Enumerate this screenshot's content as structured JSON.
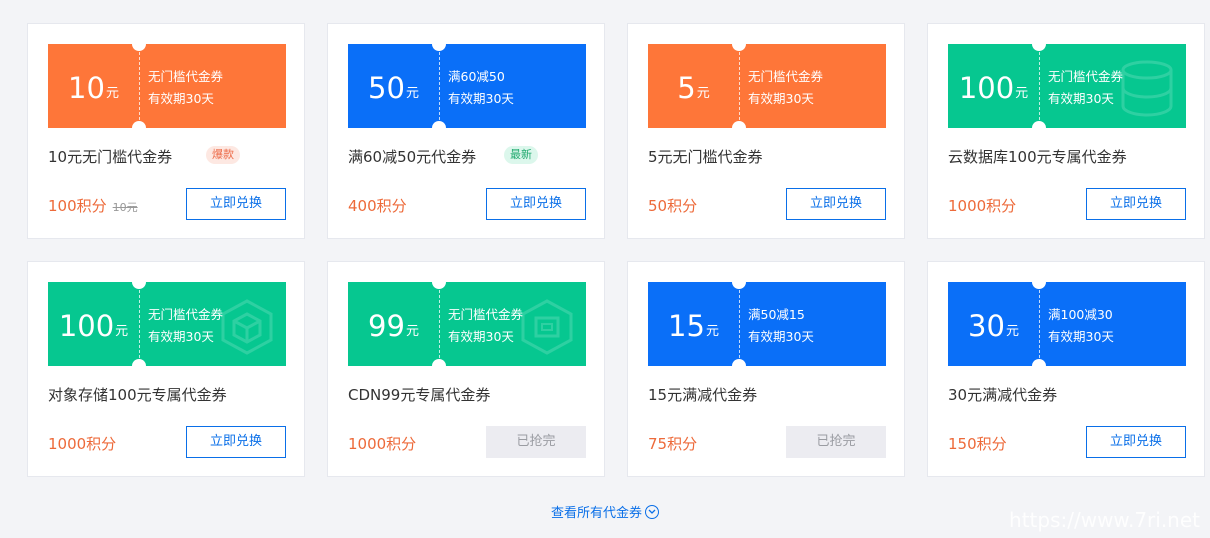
{
  "colors": {
    "orange": "#fe7639",
    "blue": "#0a6ff8",
    "green": "#06c790",
    "price": "#ed6a3a",
    "link": "#0a6fe8"
  },
  "coupons": [
    {
      "amount": "10",
      "unit": "元",
      "line1": "无门槛代金券",
      "line2": "有效期30天",
      "name": "10元无门槛代金券",
      "badge": "爆款",
      "price": "100积分",
      "original_price": "10元",
      "button": "立即兑换",
      "color": "orange",
      "available": true,
      "watermark": "none"
    },
    {
      "amount": "50",
      "unit": "元",
      "line1": "满60减50",
      "line2": "有效期30天",
      "name": "满60减50元代金券",
      "badge": "最新",
      "price": "400积分",
      "button": "立即兑换",
      "color": "blue",
      "available": true,
      "watermark": "none"
    },
    {
      "amount": "5",
      "unit": "元",
      "line1": "无门槛代金券",
      "line2": "有效期30天",
      "name": "5元无门槛代金券",
      "price": "50积分",
      "button": "立即兑换",
      "color": "orange",
      "available": true,
      "watermark": "none"
    },
    {
      "amount": "100",
      "unit": "元",
      "line1": "无门槛代金券",
      "line2": "有效期30天",
      "name": "云数据库100元专属代金券",
      "price": "1000积分",
      "button": "立即兑换",
      "color": "green",
      "available": true,
      "watermark": "database-icon"
    },
    {
      "amount": "100",
      "unit": "元",
      "line1": "无门槛代金券",
      "line2": "有效期30天",
      "name": "对象存储100元专属代金券",
      "price": "1000积分",
      "button": "立即兑换",
      "color": "green",
      "available": true,
      "watermark": "cube-icon"
    },
    {
      "amount": "99",
      "unit": "元",
      "line1": "无门槛代金券",
      "line2": "有效期30天",
      "name": "CDN99元专属代金券",
      "price": "1000积分",
      "button": "已抢完",
      "color": "green",
      "available": false,
      "watermark": "network-icon"
    },
    {
      "amount": "15",
      "unit": "元",
      "line1": "满50减15",
      "line2": "有效期30天",
      "name": "15元满减代金券",
      "price": "75积分",
      "button": "已抢完",
      "color": "blue",
      "available": false,
      "watermark": "none"
    },
    {
      "amount": "30",
      "unit": "元",
      "line1": "满100减30",
      "line2": "有效期30天",
      "name": "30元满减代金券",
      "price": "150积分",
      "button": "立即兑换",
      "color": "blue",
      "available": true,
      "watermark": "none"
    }
  ],
  "view_all": "查看所有代金券",
  "site_watermark": "https://www.7ri.net"
}
